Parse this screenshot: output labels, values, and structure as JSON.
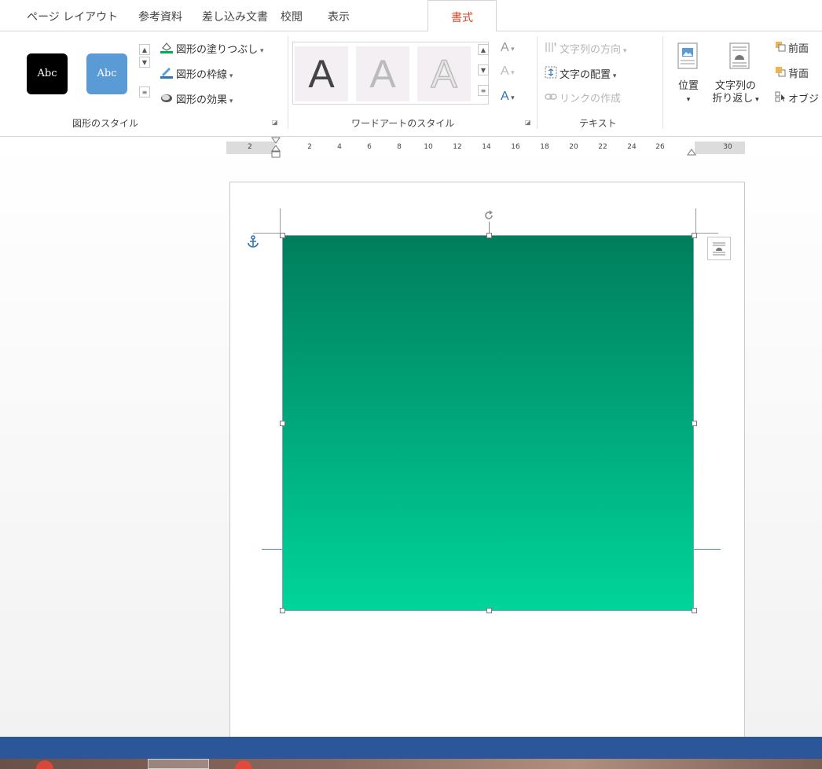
{
  "tabs": [
    {
      "label": "ページ レイアウト"
    },
    {
      "label": "参考資料"
    },
    {
      "label": "差し込み文書"
    },
    {
      "label": "校閲"
    },
    {
      "label": "表示"
    },
    {
      "label": "書式"
    }
  ],
  "active_tab": "書式",
  "ribbon": {
    "shape_styles": {
      "thumb_dark": "Abc",
      "thumb_blue": "Abc",
      "fill": "図形の塗りつぶし",
      "outline": "図形の枠線",
      "effects": "図形の効果",
      "group_label": "図形のスタイル"
    },
    "wordart": {
      "tile1": "A",
      "tile2": "A",
      "tile3": "A",
      "fill": "A",
      "outline": "A",
      "effects": "A",
      "group_label": "ワードアートのスタイル"
    },
    "text": {
      "direction": "文字列の方向",
      "align": "文字の配置",
      "link": "リンクの作成",
      "group_label": "テキスト"
    },
    "arrange": {
      "position": "位置",
      "wrap_line1": "文字列の",
      "wrap_line2": "折り返し",
      "bring_forward": "前面",
      "send_backward": "背面",
      "selection_pane": "オブジ"
    }
  },
  "ruler": {
    "labels": [
      "2",
      "2",
      "4",
      "6",
      "8",
      "10",
      "12",
      "14",
      "16",
      "18",
      "20",
      "22",
      "24",
      "26",
      "30"
    ]
  },
  "shape": {
    "gradient_top": "#007e5c",
    "gradient_bottom": "#00d59a"
  },
  "colors": {
    "accent_tab": "#d24726",
    "statusbar": "#2b579a"
  }
}
